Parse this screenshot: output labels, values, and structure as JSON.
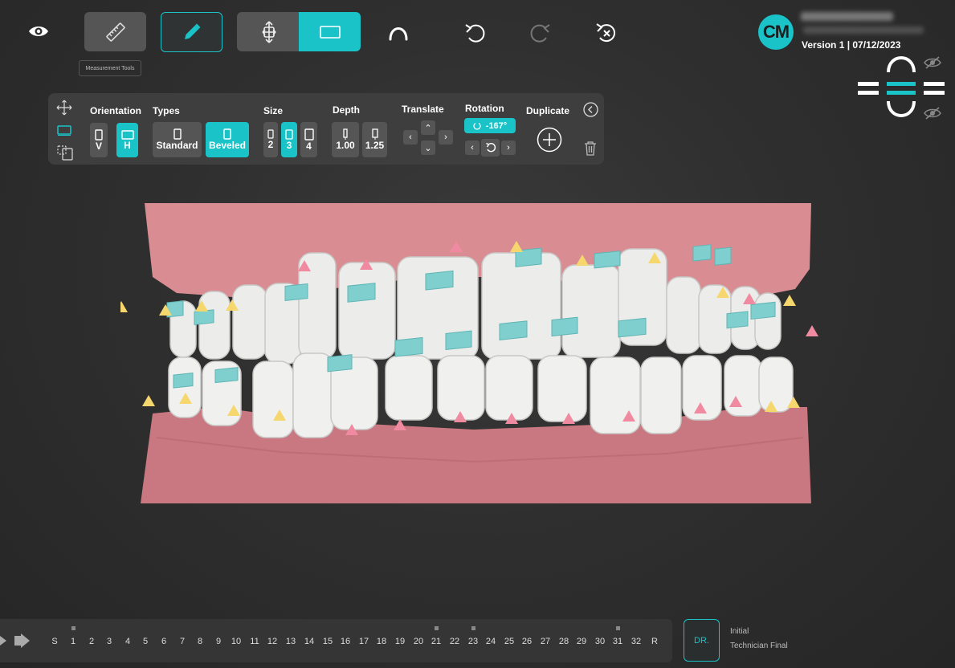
{
  "toolbar": {
    "tooltip": "Measurement Tools"
  },
  "user": {
    "initials": "CM",
    "version": "Version 1 | 07/12/2023"
  },
  "panel": {
    "orientation": {
      "label": "Orientation",
      "options": [
        "V",
        "H"
      ],
      "selected": "H"
    },
    "types": {
      "label": "Types",
      "options": [
        "Standard",
        "Beveled"
      ],
      "selected": "Beveled"
    },
    "size": {
      "label": "Size",
      "options": [
        "2",
        "3",
        "4"
      ],
      "selected": "3"
    },
    "depth": {
      "label": "Depth",
      "options": [
        "1.00",
        "1.25"
      ]
    },
    "translate": {
      "label": "Translate"
    },
    "rotation": {
      "label": "Rotation",
      "value": "-167°"
    },
    "duplicate": {
      "label": "Duplicate"
    }
  },
  "timeline": {
    "stages": [
      "S",
      "1",
      "2",
      "3",
      "4",
      "5",
      "6",
      "7",
      "8",
      "9",
      "10",
      "11",
      "12",
      "13",
      "14",
      "15",
      "16",
      "17",
      "18",
      "19",
      "20",
      "21",
      "22",
      "23",
      "24",
      "25",
      "26",
      "27",
      "28",
      "29",
      "30",
      "31",
      "32",
      "R"
    ],
    "marked": [
      "1",
      "21",
      "23",
      "31"
    ],
    "dr_label": "DR.",
    "stage_names": [
      "Initial",
      "Technician Final"
    ]
  },
  "colors": {
    "accent": "#19c3c8",
    "gum": "#d98c92",
    "tooth": "#ececea",
    "attachment": "#7fcfcf",
    "marker_yellow": "#f5d76e",
    "marker_pink": "#f08aa0"
  },
  "icons": {
    "visibility": "eye-icon",
    "measure": "ruler-icon",
    "edit": "pencil-icon",
    "move": "move-bracket-icon",
    "rect": "rectangle-icon",
    "arch": "arch-icon",
    "undo": "undo-icon",
    "redo": "redo-icon",
    "reset": "reset-icon",
    "jaw": "jaw-view-icon",
    "hide": "eye-off-icon"
  }
}
